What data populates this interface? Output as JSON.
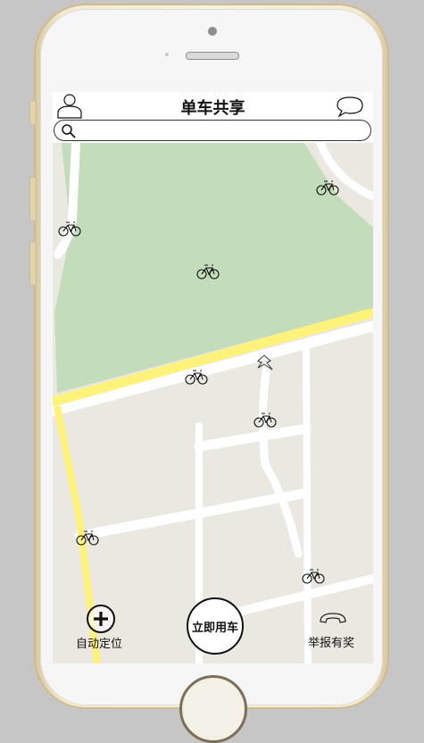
{
  "app": {
    "title": "单车共享"
  },
  "search": {
    "placeholder": ""
  },
  "actions": {
    "locate_label": "自动定位",
    "ride_label": "立即用车",
    "report_label": "举报有奖"
  },
  "icons": {
    "user": "user-icon",
    "message": "message-bubble-icon",
    "search": "search-icon",
    "bike": "bicycle-icon",
    "locate": "plus-circle-icon",
    "phone": "phone-icon",
    "pin": "map-pin-icon"
  },
  "colors": {
    "park": "#c3dcb9",
    "land": "#ebe7e1",
    "road": "#ffffff",
    "highway": "#fef27a"
  },
  "bikes_count_visible": 8
}
